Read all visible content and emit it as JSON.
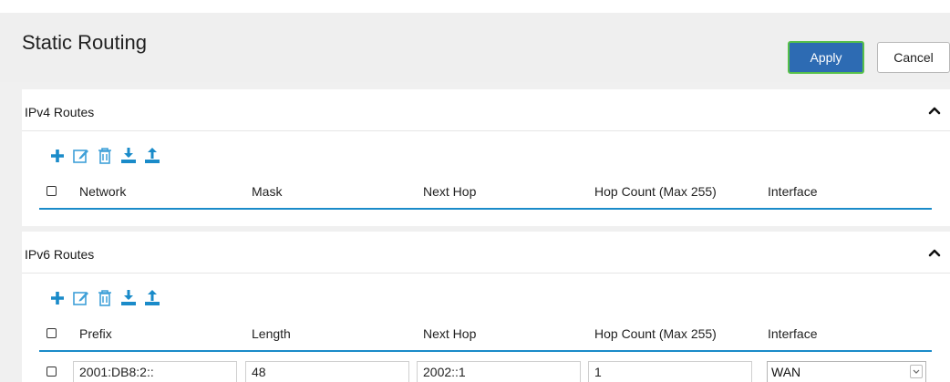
{
  "header": {
    "title": "Static Routing",
    "apply_label": "Apply",
    "cancel_label": "Cancel"
  },
  "ipv4": {
    "title": "IPv4 Routes",
    "columns": [
      "Network",
      "Mask",
      "Next Hop",
      "Hop Count (Max 255)",
      "Interface"
    ]
  },
  "ipv6": {
    "title": "IPv6 Routes",
    "columns": [
      "Prefix",
      "Length",
      "Next Hop",
      "Hop Count (Max 255)",
      "Interface"
    ],
    "rows": [
      {
        "prefix": "2001:DB8:2::",
        "length": "48",
        "next_hop": "2002::1",
        "hop_count": "1",
        "interface": "WAN"
      }
    ]
  },
  "colors": {
    "accent_blue": "#2d6bb3",
    "apply_focus": "#57c04a",
    "toolbar_icon": "#1a8bc9",
    "table_rule": "#1a8bc9"
  },
  "icons": [
    "add-icon",
    "edit-icon",
    "delete-icon",
    "download-icon",
    "upload-icon",
    "chevron-up-icon",
    "chevron-down-icon"
  ]
}
